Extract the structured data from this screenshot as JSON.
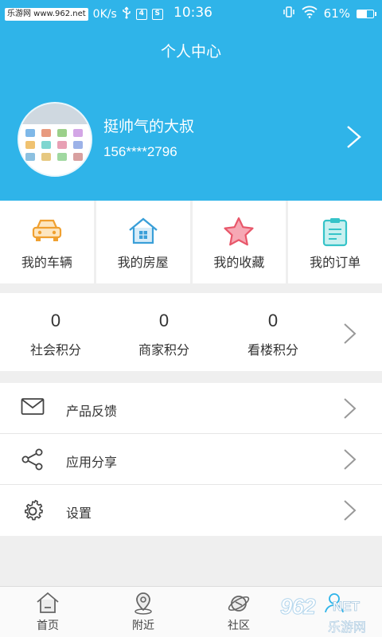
{
  "status_bar": {
    "watermark": "乐游网 www.962.net",
    "speed": "0K/s",
    "sim_badge": "S",
    "time": "10:36",
    "battery_text": "61%",
    "battery_level": 0.61
  },
  "header": {
    "title": "个人中心",
    "user_name": "挺帅气的大叔",
    "phone": "156****2796"
  },
  "quick_nav": [
    {
      "label": "我的车辆",
      "icon": "car-icon",
      "color": "#f0a030"
    },
    {
      "label": "我的房屋",
      "icon": "house-icon",
      "color": "#3a9fd8"
    },
    {
      "label": "我的收藏",
      "icon": "star-icon",
      "color": "#e8576a"
    },
    {
      "label": "我的订单",
      "icon": "clipboard-icon",
      "color": "#35c3c8"
    }
  ],
  "points": [
    {
      "value": "0",
      "label": "社会积分"
    },
    {
      "value": "0",
      "label": "商家积分"
    },
    {
      "value": "0",
      "label": "看楼积分"
    }
  ],
  "menu": [
    {
      "label": "产品反馈",
      "icon": "mail-icon"
    },
    {
      "label": "应用分享",
      "icon": "share-icon"
    },
    {
      "label": "设置",
      "icon": "gear-icon"
    }
  ],
  "bottom_nav": [
    {
      "label": "首页",
      "icon": "home-icon"
    },
    {
      "label": "附近",
      "icon": "location-icon"
    },
    {
      "label": "社区",
      "icon": "planet-icon"
    },
    {
      "label": "",
      "icon": "profile-icon"
    }
  ],
  "watermark_bottom": {
    "number": "962",
    "suffix": "NET",
    "name": "乐游网"
  },
  "colors": {
    "header": "#2fb4e9",
    "background": "#efefef"
  }
}
